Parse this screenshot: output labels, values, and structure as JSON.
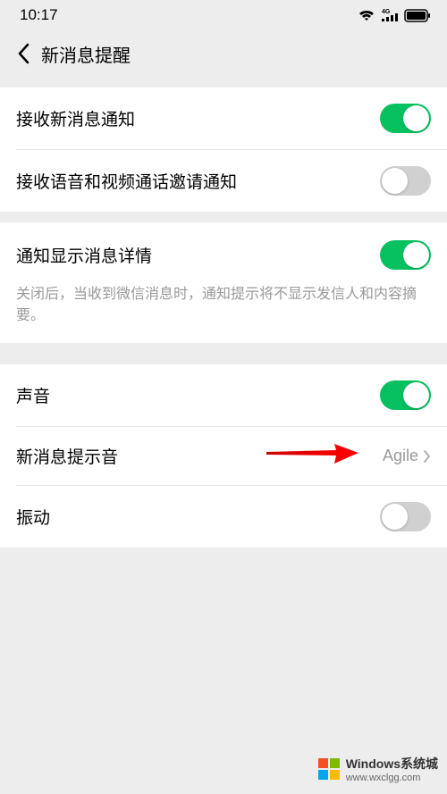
{
  "statusBar": {
    "time": "10:17"
  },
  "header": {
    "title": "新消息提醒"
  },
  "section1": {
    "receiveNewMessages": {
      "label": "接收新消息通知",
      "on": true
    },
    "receiveVoiceVideo": {
      "label": "接收语音和视频通话邀请通知",
      "on": false
    }
  },
  "section2": {
    "showDetails": {
      "label": "通知显示消息详情",
      "on": true,
      "description": "关闭后，当收到微信消息时，通知提示将不显示发信人和内容摘要。"
    }
  },
  "section3": {
    "sound": {
      "label": "声音",
      "on": true
    },
    "notificationSound": {
      "label": "新消息提示音",
      "value": "Agile"
    },
    "vibrate": {
      "label": "振动",
      "on": false
    }
  },
  "watermark": {
    "name": "Windows系统城",
    "url": "www.wxclgg.com"
  }
}
